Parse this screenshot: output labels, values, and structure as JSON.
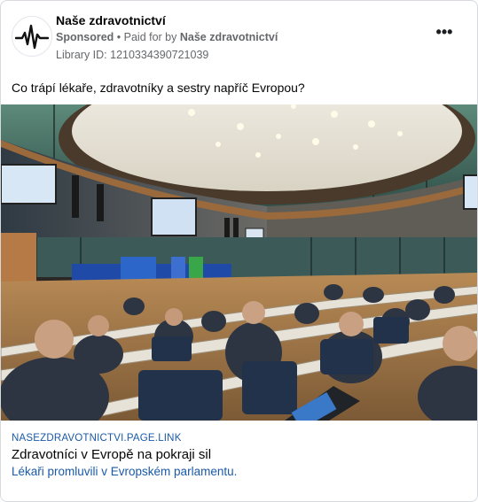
{
  "header": {
    "page_name": "Naše zdravotnictví",
    "sponsored_label": "Sponsored",
    "separator": " • ",
    "paid_for_label": "Paid for by ",
    "payer": "Naše zdravotnictví",
    "library_id": "Library ID: 1210334390721039",
    "avatar_icon": "heartbeat-pulse-icon",
    "more_icon": "more-options-icon",
    "more_glyph": "•••"
  },
  "post": {
    "text": "Co trápí lékaře, zdravotníky a sestry napříč Evropou?"
  },
  "image": {
    "description_icon": "conference-hall-photo"
  },
  "link_preview": {
    "domain": "NASEZDRAVOTNICTVI.PAGE.LINK",
    "title": "Zdravotníci v Evropě na pokraji sil",
    "description": "Lékaři promluvili v Evropském parlamentu."
  },
  "colors": {
    "link_blue": "#1a5aa8",
    "meta_gray": "#65676b"
  }
}
